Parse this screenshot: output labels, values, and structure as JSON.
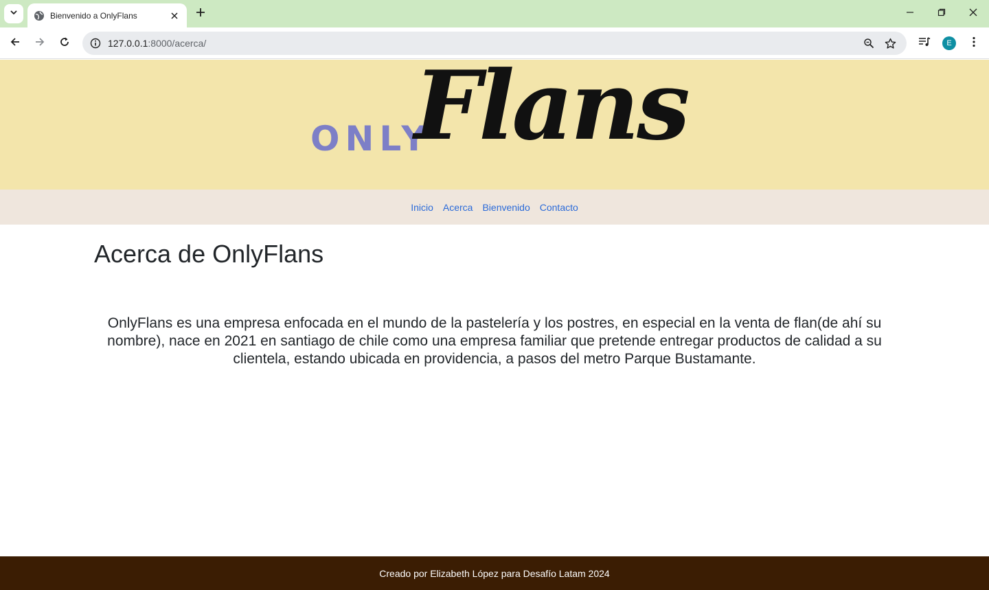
{
  "browser": {
    "tab_title": "Bienvenido a OnlyFlans",
    "url_host": "127.0.0.1",
    "url_path": ":8000/acerca/",
    "profile_initial": "E",
    "icons": [
      "chevron-down-icon",
      "globe-icon",
      "close-icon",
      "plus-icon",
      "minimize-icon",
      "restore-icon",
      "back-arrow-icon",
      "forward-arrow-icon",
      "reload-icon",
      "info-icon",
      "zoom-icon",
      "star-icon",
      "media-control-icon",
      "kebab-menu-icon"
    ],
    "colors": {
      "tabbar_bg": "#cde9c2",
      "omnibox_bg": "#e9ebee",
      "avatar_bg": "#0e8fa3"
    }
  },
  "site": {
    "logo_only": "ONLY",
    "logo_flans": "Flans",
    "nav": [
      {
        "label": "Inicio"
      },
      {
        "label": "Acerca"
      },
      {
        "label": "Bienvenido"
      },
      {
        "label": "Contacto"
      }
    ],
    "page_title": "Acerca de OnlyFlans",
    "about_text": "OnlyFlans es una empresa enfocada en el mundo de la pastelería y los postres, en especial en la venta de flan(de ahí su nombre), nace en 2021 en santiago de chile como una empresa familiar que pretende entregar productos de calidad a su clientela, estando ubicada en providencia, a pasos del metro Parque Bustamante.",
    "footer_text": "Creado por Elizabeth López para Desafío Latam 2024",
    "colors": {
      "hero_bg": "#f3e5ab",
      "nav_bg": "#efe6dd",
      "link": "#2a6ad9",
      "logo_only": "#7d7fc7",
      "footer_bg": "#3b1d03"
    }
  }
}
